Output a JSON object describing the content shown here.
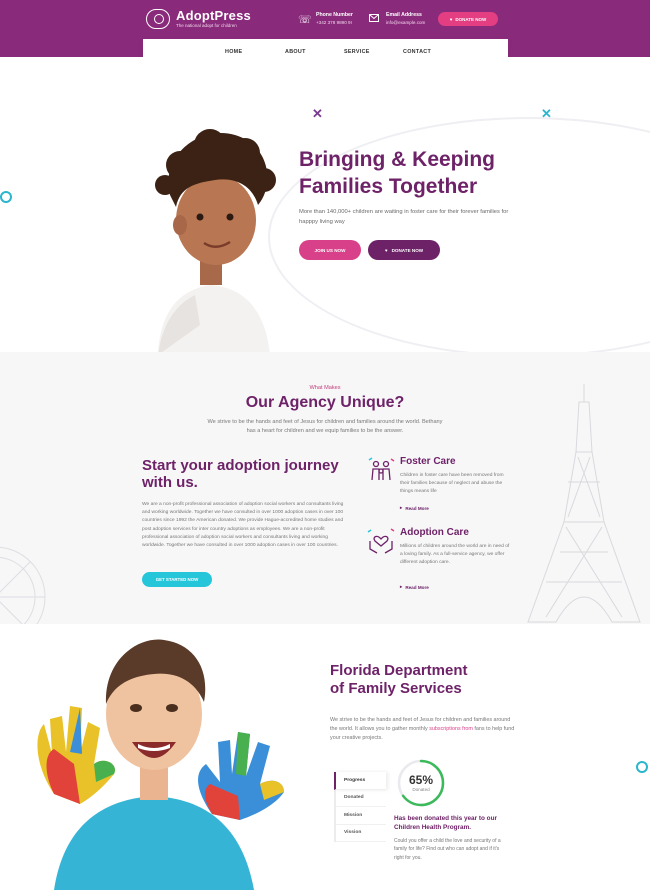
{
  "colors": {
    "brand_purple": "#8a2a7b",
    "heading_purple": "#6e2268",
    "pink": "#e33e82",
    "teal": "#26c6da",
    "green": "#3cb95b"
  },
  "header": {
    "logo_name": "AdoptPress",
    "logo_tagline": "The national adopt for children",
    "phone_label": "Phone Number",
    "phone_value": "+342 378 9890 9I",
    "email_label": "Email Address",
    "email_value": "info@example.com",
    "donate_label": "DONATE NOW",
    "icons": {
      "phone": "phone-icon",
      "email": "email-icon",
      "donate": "heart-icon"
    }
  },
  "nav": {
    "items": [
      "HOME",
      "ABOUT",
      "SERVICE",
      "CONTACT"
    ]
  },
  "hero": {
    "title_line1": "Bringing & Keeping",
    "title_line2": "Families Together",
    "description": "More than 140,000+ children are waiting in foster care for their forever families for happpy living way",
    "join_label": "JOIN US NOW",
    "donate_label": "DONATE NOW"
  },
  "unique": {
    "eyebrow": "What Makes",
    "title": "Our Agency Unique?",
    "subtitle": "We strive to be the hands and feet of Jesus for children and families around the world. Bethany has a heart for children and we equip families to be the answer.",
    "start_title": "Start your adoption journey with us.",
    "start_body": "We are a non-profit professional association of adoption social workers and consultants living and working worldwide. Together we have consulted in over 1000 adoption cases in over 100 countries since 1992 the American donated. We provide Hague-accredited home studies and post adoption services for inter country adoptions as employees. We are a non-profit professional association of adoption social workers and consultants living and working worldwide. Together we have consulted in over 1000 adoption cases in over 100 countries.",
    "start_button": "GET STARTED NOW",
    "features": [
      {
        "title": "Foster Care",
        "body": "Children in foster care have been removed from their families because of neglect and abuse the things means life",
        "more": "Read More",
        "icon": "family-icon"
      },
      {
        "title": "Adoption Care",
        "body": "Millions of children around the world are in need of a loving family. As a full-service agency, we offer different adoption care.",
        "more": "Read More",
        "icon": "hands-heart-icon"
      }
    ]
  },
  "florida": {
    "title_line1": "Florida Department",
    "title_line2": "of Family Services",
    "body_start": "We strive to be the hands and feet of Jesus for children and families around the world. It allows you to gather monthly ",
    "body_link": "subscriptions from",
    "body_end": " fans to help fund your creative projects.",
    "tabs": [
      "Progress",
      "Donated",
      "Mission",
      "Vission"
    ],
    "progress_value": "65%",
    "progress_fraction": 0.65,
    "progress_label": "Donated",
    "donated_title": "Has been donated this year to our Children Health Program.",
    "donated_body": "Could you offer a child the love and security of a family for life? Find out who can adopt and if it's right for you."
  }
}
